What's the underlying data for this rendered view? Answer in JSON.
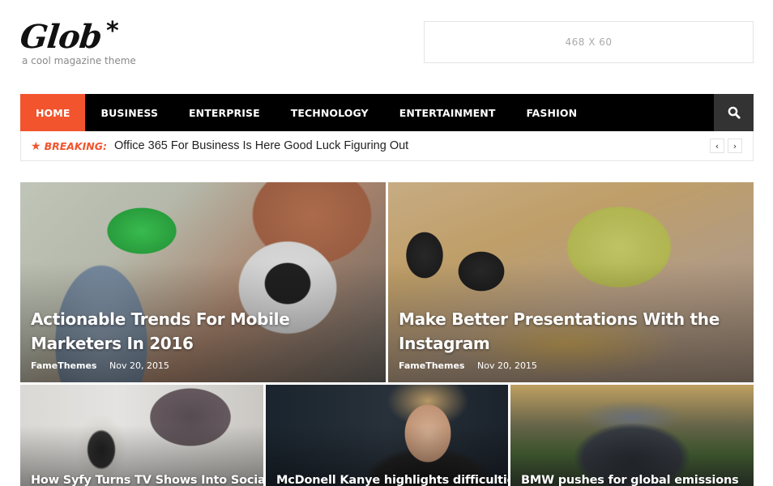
{
  "site": {
    "title": "Glob",
    "title_mark": "*",
    "tagline": "a cool magazine theme"
  },
  "ad": {
    "label": "468 X 60"
  },
  "nav": {
    "items": [
      {
        "label": "HOME",
        "active": true
      },
      {
        "label": "BUSINESS",
        "active": false
      },
      {
        "label": "ENTERPRISE",
        "active": false
      },
      {
        "label": "TECHNOLOGY",
        "active": false
      },
      {
        "label": "ENTERTAINMENT",
        "active": false
      },
      {
        "label": "FASHION",
        "active": false
      }
    ],
    "search_icon": "search-icon",
    "accent_color": "#f2542d"
  },
  "breaking": {
    "icon": "star-icon",
    "label": "BREAKING:",
    "headline": "Office 365 For Business Is Here Good Luck Figuring Out",
    "prev": "‹",
    "next": "›"
  },
  "featured": {
    "big": [
      {
        "title": "Actionable Trends For Mobile Marketers In 2016",
        "author": "FameThemes",
        "date": "Nov 20, 2015"
      },
      {
        "title": "Make Better Presentations With the Instagram",
        "author": "FameThemes",
        "date": "Nov 20, 2015"
      }
    ],
    "small": [
      {
        "title": "How Syfy Turns TV Shows Into Social"
      },
      {
        "title": "McDonell Kanye highlights difficulties"
      },
      {
        "title": "BMW pushes for global emissions"
      }
    ]
  }
}
